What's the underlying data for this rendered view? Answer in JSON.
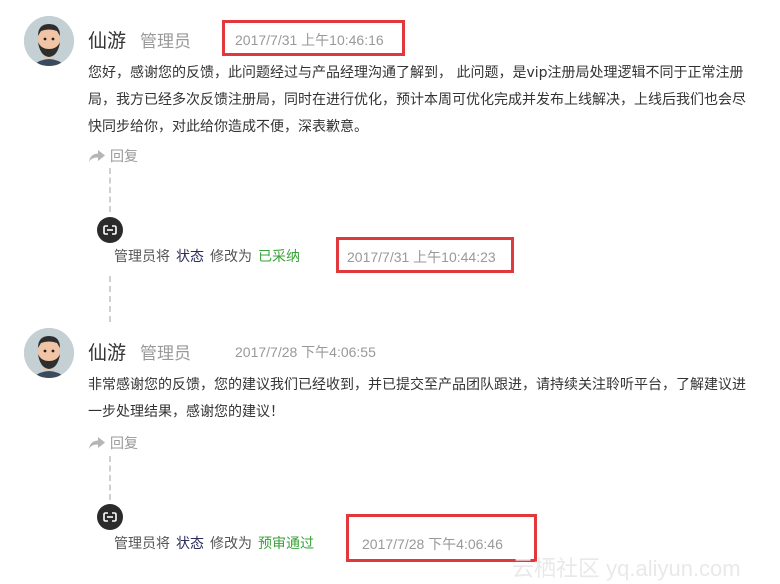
{
  "comments": [
    {
      "author": "仙游",
      "role": "管理员",
      "time": "2017/7/31 上午10:46:16",
      "body": "您好，感谢您的反馈，此问题经过与产品经理沟通了解到， 此问题，是vip注册局处理逻辑不同于正常注册局，我方已经多次反馈注册局，同时在进行优化，预计本周可优化完成并发布上线解决，上线后我们也会尽快同步给你，对此给你造成不便，深表歉意。",
      "reply_label": "回复",
      "status_change": {
        "actor_text": "管理员将",
        "field": "状态",
        "action_text": "修改为",
        "value": "已采纳",
        "time": "2017/7/31 上午10:44:23"
      }
    },
    {
      "author": "仙游",
      "role": "管理员",
      "time": "2017/7/28 下午4:06:55",
      "body": "非常感谢您的反馈，您的建议我们已经收到，并已提交至产品团队跟进，请持续关注聆听平台，了解建议进一步处理结果，感谢您的建议！",
      "reply_label": "回复",
      "status_change": {
        "actor_text": "管理员将",
        "field": "状态",
        "action_text": "修改为",
        "value": "预审通过",
        "time": "2017/7/28 下午4:06:46"
      }
    }
  ],
  "watermark": "云栖社区 yq.aliyun.com",
  "colors": {
    "highlight_box": "#e0383c",
    "status_value": "#3aa23a",
    "muted_text": "#999999"
  }
}
